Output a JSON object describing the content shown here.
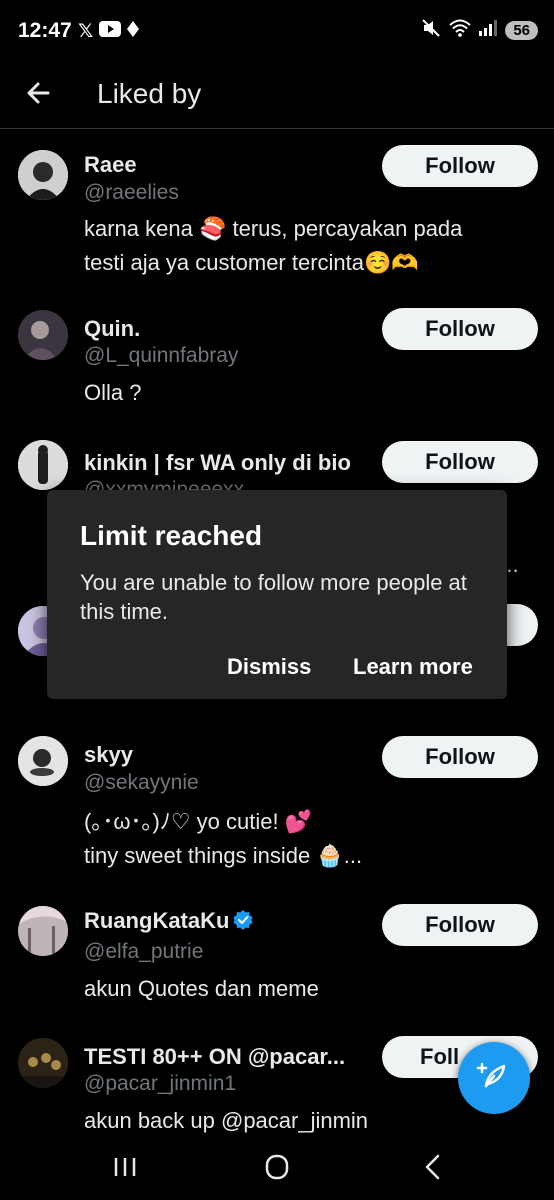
{
  "status_bar": {
    "time": "12:47",
    "battery": "56"
  },
  "header": {
    "title": "Liked by"
  },
  "users": [
    {
      "name": "Raee",
      "handle": "@raeelies",
      "bio1": "karna kena 🍣 terus, percayakan pada",
      "bio2": "testi aja ya customer tercinta☺️🫶",
      "follow": "Follow"
    },
    {
      "name": "Quin.",
      "handle": "@L_quinnfabray",
      "bio1": "Olla ?",
      "follow": "Follow"
    },
    {
      "name": "kinkin | fsr WA only di bio",
      "handle": "@xxmymineeexx",
      "follow": "Follow",
      "bio_tail": "a..."
    },
    {
      "name": "",
      "handle": ""
    },
    {
      "name": "skyy",
      "handle": "@sekayynie",
      "bio1": "(｡･ω･｡)ﾉ♡ yo cutie! 💕",
      "bio2": "tiny sweet things inside 🧁...",
      "follow": "Follow"
    },
    {
      "name": "RuangKataKu",
      "handle": "@elfa_putrie",
      "bio1": "akun Quotes dan meme",
      "follow": "Follow",
      "verified": true
    },
    {
      "name": "TESTI 80++ ON @pacar...",
      "handle": "@pacar_jinmin1",
      "bio1": "akun back up @pacar_jinmin",
      "follow": "Foll"
    }
  ],
  "dialog": {
    "title": "Limit reached",
    "message": "You are unable to follow more people at this time.",
    "dismiss": "Dismiss",
    "learn_more": "Learn more"
  },
  "colors": {
    "accent": "#1d9bf0",
    "background": "#000000",
    "dialog": "#262626",
    "muted": "#71767b"
  },
  "icons": [
    "back-arrow-icon",
    "compose-icon",
    "verified-badge-icon",
    "nav-recents-icon",
    "nav-home-icon",
    "nav-back-icon"
  ]
}
